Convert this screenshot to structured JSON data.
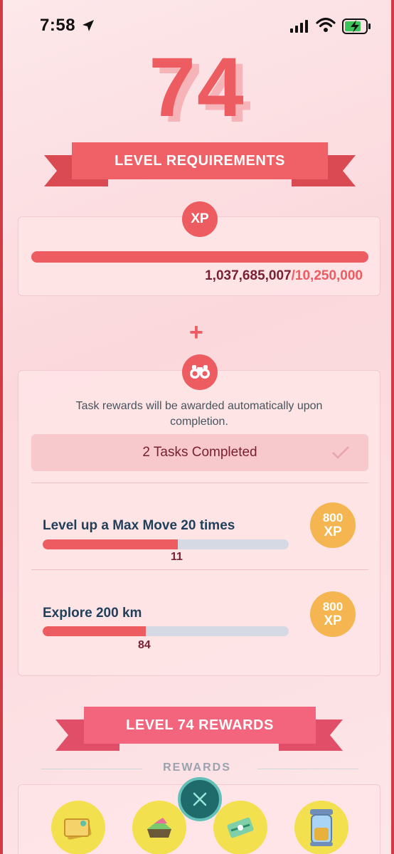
{
  "status_bar": {
    "time": "7:58"
  },
  "level": "74",
  "requirements": {
    "title": "LEVEL REQUIREMENTS"
  },
  "xp": {
    "badge": "XP",
    "current": "1,037,685,007",
    "separator": "/",
    "required": "10,250,000",
    "progress_fraction": 1.0
  },
  "plus_symbol": "+",
  "tasks": {
    "note": "Task rewards will be awarded automatically upon completion.",
    "completed_label": "2 Tasks Completed",
    "items": [
      {
        "title": "Level up a Max Move 20 times",
        "progress": "11",
        "progress_fraction": 0.55,
        "reward_amount": "800",
        "reward_unit": "XP"
      },
      {
        "title": "Explore 200 km",
        "progress": "84",
        "progress_fraction": 0.42,
        "reward_amount": "800",
        "reward_unit": "XP"
      }
    ]
  },
  "rewards_section": {
    "title": "LEVEL 74 REWARDS",
    "label": "REWARDS",
    "items": [
      "premium-battle-pass-icon",
      "poffin-icon",
      "rocket-radar-icon",
      "max-particle-pack-icon"
    ]
  },
  "colors": {
    "accent": "#ec5c60",
    "reward_bg": "#f3e04e",
    "xp_badge": "#f5b550",
    "close_button": "#1f6b6b"
  }
}
